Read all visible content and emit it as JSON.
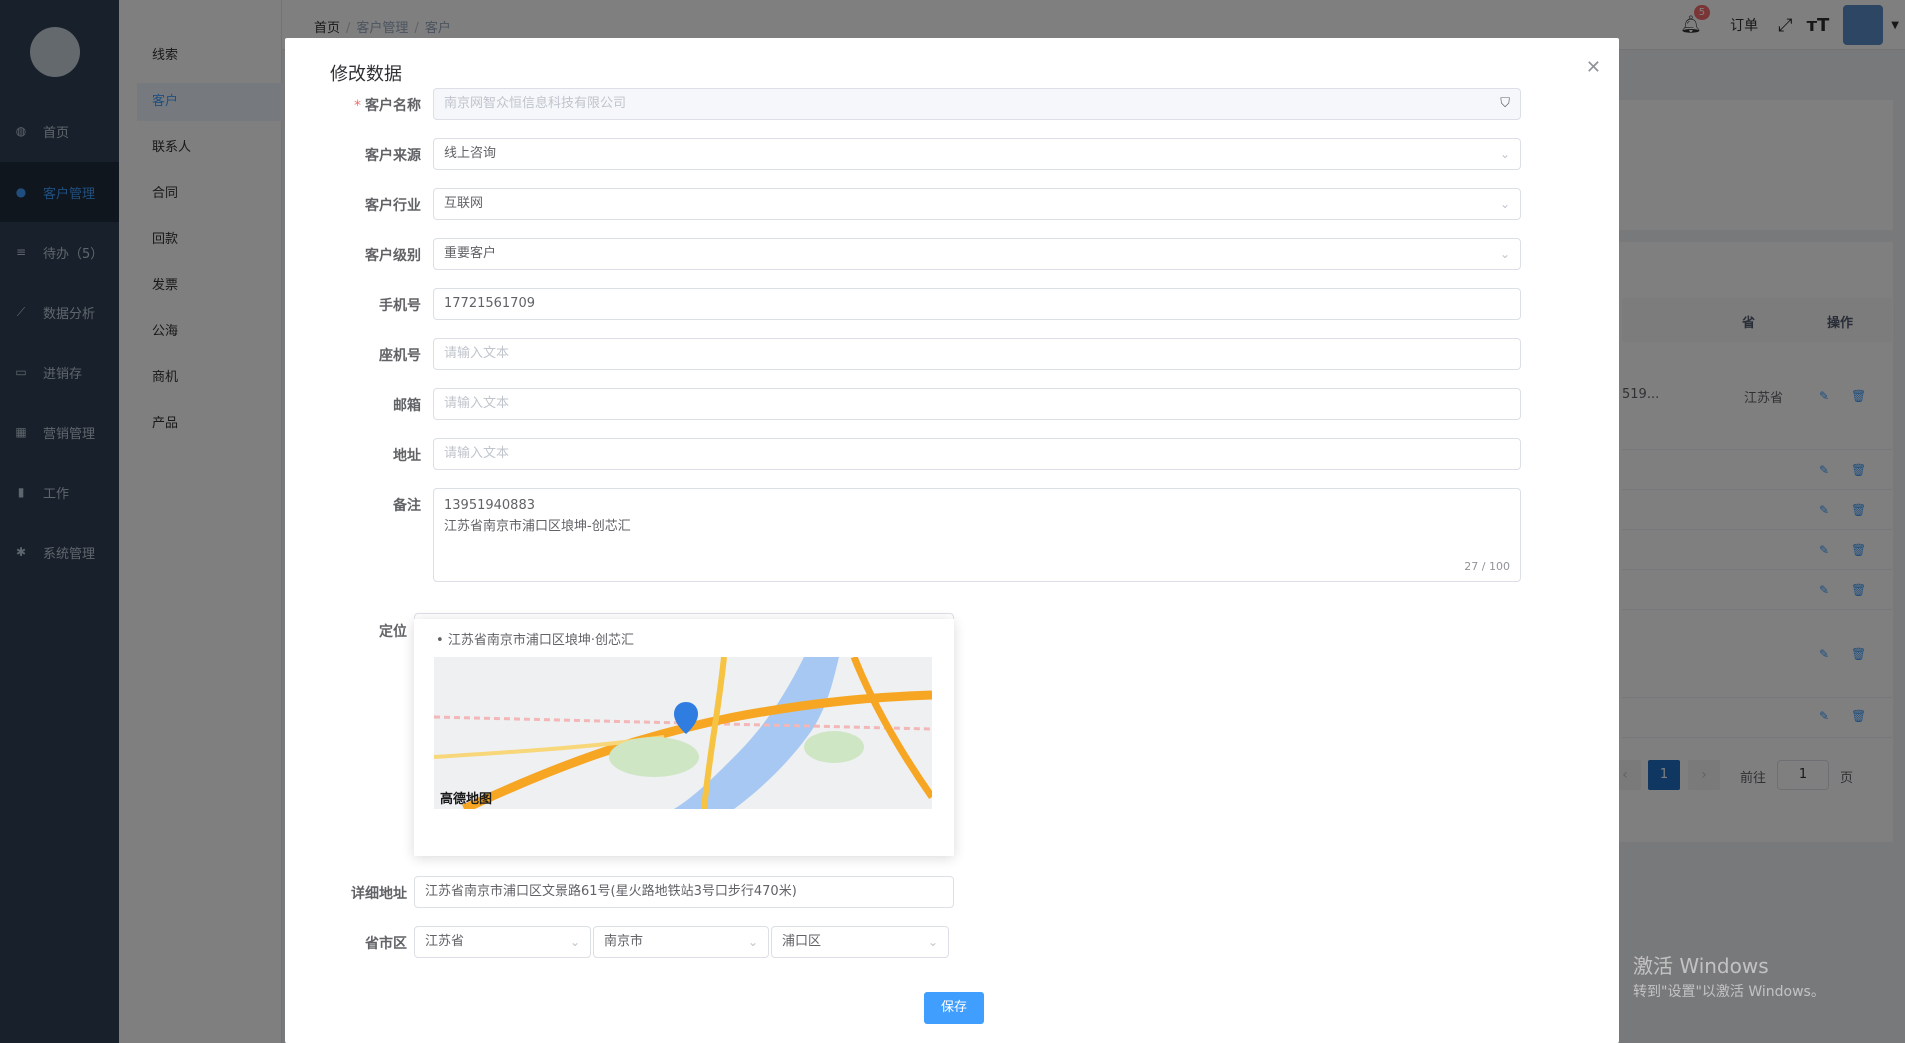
{
  "sidebar": {
    "items": [
      {
        "label": "首页",
        "icon": "dashboard-icon"
      },
      {
        "label": "客户管理",
        "icon": "user-icon"
      },
      {
        "label": "待办（5）",
        "icon": "sliders-icon"
      },
      {
        "label": "数据分析",
        "icon": "line-chart-icon"
      },
      {
        "label": "进销存",
        "icon": "folder-icon"
      },
      {
        "label": "营销管理",
        "icon": "calculator-icon"
      },
      {
        "label": "工作",
        "icon": "book-icon"
      },
      {
        "label": "系统管理",
        "icon": "gear-icon"
      }
    ]
  },
  "submenu": {
    "items": [
      "线索",
      "客户",
      "联系人",
      "合同",
      "回款",
      "发票",
      "公海",
      "商机",
      "产品"
    ]
  },
  "header": {
    "breadcrumb": [
      "首页",
      "客户管理",
      "客户"
    ],
    "notification_count": "5",
    "order_label": "订单"
  },
  "background": {
    "table_headers": [
      "省",
      "操作"
    ],
    "row_partial": "519...",
    "row_province": "江苏省",
    "pager_current": "1",
    "goto_label": "前往",
    "goto_value": "1",
    "page_unit": "页"
  },
  "dialog": {
    "title": "修改数据",
    "fields": {
      "customer_name": {
        "label": "客户名称",
        "value": "南京网智众恒信息科技有限公司"
      },
      "source": {
        "label": "客户来源",
        "value": "线上咨询"
      },
      "industry": {
        "label": "客户行业",
        "value": "互联网"
      },
      "level": {
        "label": "客户级别",
        "value": "重要客户"
      },
      "mobile": {
        "label": "手机号",
        "value": "17721561709"
      },
      "landline": {
        "label": "座机号",
        "placeholder": "请输入文本"
      },
      "email": {
        "label": "邮箱",
        "placeholder": "请输入文本"
      },
      "address": {
        "label": "地址",
        "placeholder": "请输入文本"
      },
      "remark": {
        "label": "备注",
        "line1": "13951940883",
        "line2": "江苏省南京市浦口区埌坤-创芯汇",
        "count": "27 / 100"
      },
      "location": {
        "label": "定位",
        "value": "江苏省南京市浦口区文景路61号(星火路地铁站3号口步行470米)"
      },
      "suggestion": "江苏省南京市浦口区埌坤·创芯汇",
      "map_logo": "高德地图",
      "detail_address": {
        "label": "详细地址",
        "value": "江苏省南京市浦口区文景路61号(星火路地铁站3号口步行470米)"
      },
      "region": {
        "label": "省市区",
        "province": "江苏省",
        "city": "南京市",
        "district": "浦口区"
      }
    },
    "save_label": "保存"
  },
  "watermark": {
    "line1": "激活 Windows",
    "line2": "转到\"设置\"以激活 Windows。"
  }
}
